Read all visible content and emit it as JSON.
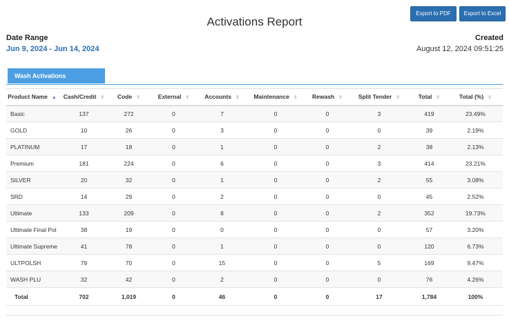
{
  "report": {
    "title": "Activations Report",
    "export_pdf": "Export to PDF",
    "export_excel": "Export to Excel",
    "date_range_label": "Date Range",
    "date_range_value": "Jun 9, 2024 - Jun 14, 2024",
    "created_label": "Created",
    "created_value": "August 12, 2024 09:51:25",
    "tab_label": "Wash Activations"
  },
  "table": {
    "headers": [
      "Product Name",
      "Cash/Credit",
      "Code",
      "External",
      "Accounts",
      "Maintenance",
      "Rewash",
      "Split Tender",
      "Total",
      "Total (%)"
    ],
    "sort_icon": "▲",
    "sort_idle_icon": "⬍",
    "rows": [
      [
        "Basic",
        "137",
        "272",
        "0",
        "7",
        "0",
        "0",
        "3",
        "419",
        "23.49%"
      ],
      [
        "GOLD",
        "10",
        "26",
        "0",
        "3",
        "0",
        "0",
        "0",
        "39",
        "2.19%"
      ],
      [
        "PLATINUM",
        "17",
        "18",
        "0",
        "1",
        "0",
        "0",
        "2",
        "38",
        "2.13%"
      ],
      [
        "Premium",
        "181",
        "224",
        "0",
        "6",
        "0",
        "0",
        "3",
        "414",
        "23.21%"
      ],
      [
        "SILVER",
        "20",
        "32",
        "0",
        "1",
        "0",
        "0",
        "2",
        "55",
        "3.08%"
      ],
      [
        "SRD",
        "14",
        "29",
        "0",
        "2",
        "0",
        "0",
        "0",
        "45",
        "2.52%"
      ],
      [
        "Ultimate",
        "133",
        "209",
        "0",
        "8",
        "0",
        "0",
        "2",
        "352",
        "19.73%"
      ],
      [
        "Ultimate Final Pol",
        "38",
        "19",
        "0",
        "0",
        "0",
        "0",
        "0",
        "57",
        "3.20%"
      ],
      [
        "Ultimate Supreme",
        "41",
        "78",
        "0",
        "1",
        "0",
        "0",
        "0",
        "120",
        "6.73%"
      ],
      [
        "ULTPOLSH",
        "79",
        "70",
        "0",
        "15",
        "0",
        "0",
        "5",
        "169",
        "9.47%"
      ],
      [
        "WASH PLU",
        "32",
        "42",
        "0",
        "2",
        "0",
        "0",
        "0",
        "76",
        "4.26%"
      ]
    ],
    "totals": [
      "Total",
      "702",
      "1,019",
      "0",
      "46",
      "0",
      "0",
      "17",
      "1,784",
      "100%"
    ]
  }
}
